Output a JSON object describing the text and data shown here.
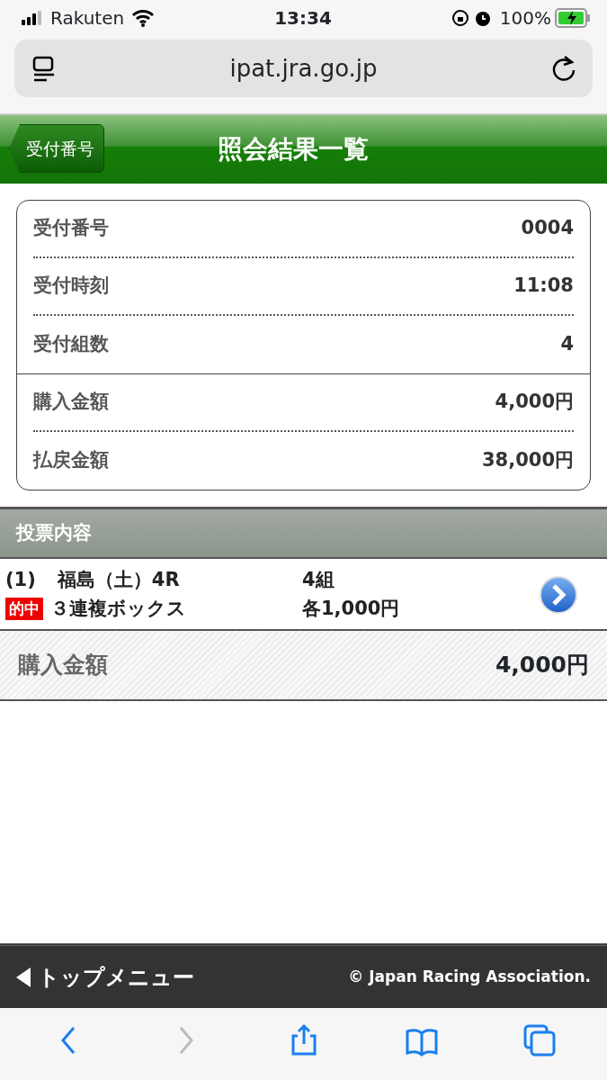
{
  "status_bar": {
    "carrier": "Rakuten",
    "time": "13:34",
    "battery": "100%"
  },
  "browser": {
    "url": "ipat.jra.go.jp"
  },
  "header": {
    "back_label": "受付番号",
    "title": "照会結果一覧"
  },
  "summary": {
    "groups": [
      [
        {
          "label": "受付番号",
          "value": "0004"
        },
        {
          "label": "受付時刻",
          "value": "11:08"
        },
        {
          "label": "受付組数",
          "value": "4"
        }
      ],
      [
        {
          "label": "購入金額",
          "value": "4,000円"
        },
        {
          "label": "払戻金額",
          "value": "38,000円"
        }
      ]
    ]
  },
  "section": {
    "title": "投票内容"
  },
  "bets": [
    {
      "index": "(1)",
      "race": "福島（土）4R",
      "count": "4組",
      "badge": "的中",
      "type": "３連複ボックス",
      "amount": "各1,000円"
    }
  ],
  "total": {
    "label": "購入金額",
    "value": "4,000円"
  },
  "footer": {
    "menu": "トップメニュー",
    "copyright": "© Japan Racing Association."
  },
  "toolbar": [
    {
      "kind": "back",
      "disabled": false
    },
    {
      "kind": "forward",
      "disabled": true
    },
    {
      "kind": "share",
      "disabled": false
    },
    {
      "kind": "bookmarks",
      "disabled": false
    },
    {
      "kind": "tabs",
      "disabled": false
    }
  ]
}
